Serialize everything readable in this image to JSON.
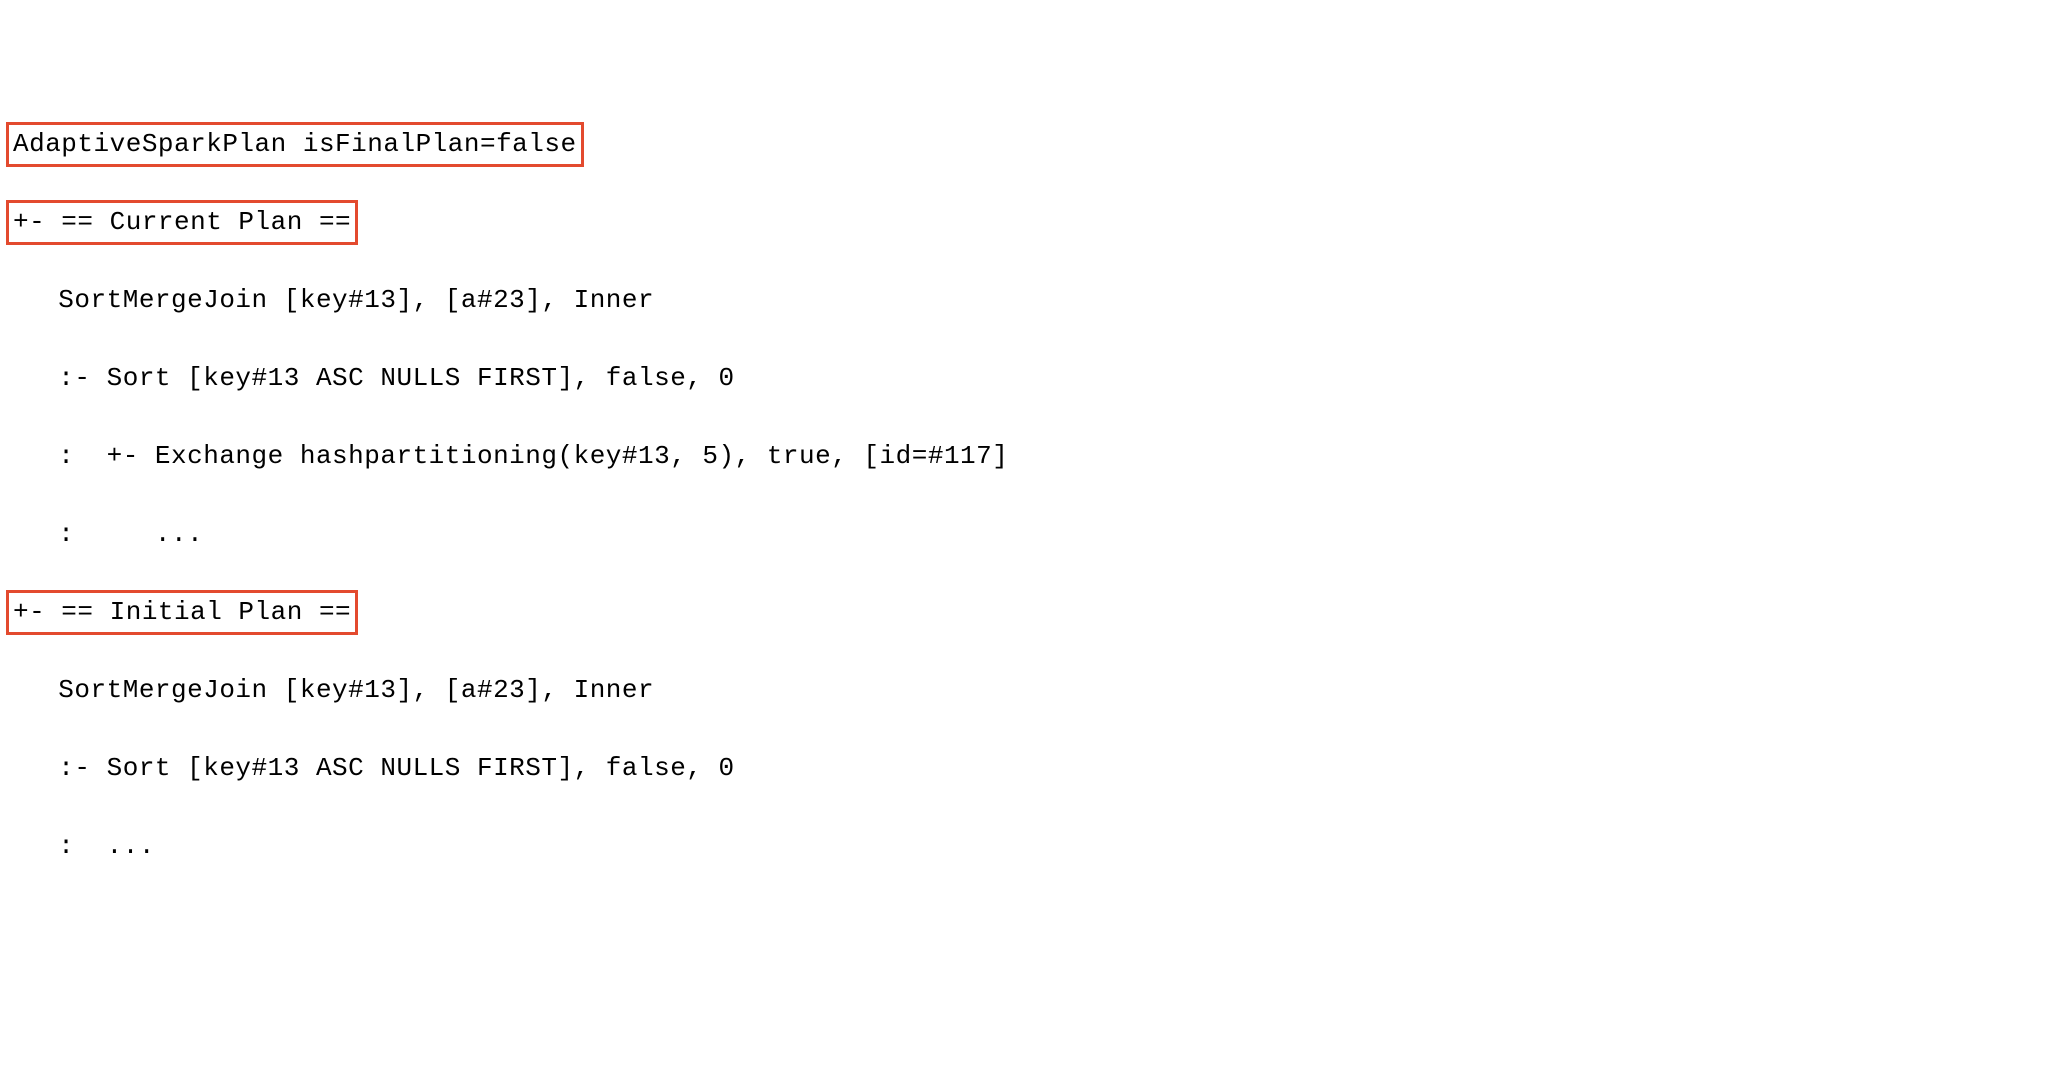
{
  "lines": {
    "l1": "AdaptiveSparkPlan isFinalPlan=false",
    "l2": "+- == Current Plan ==",
    "l3": "   SortMergeJoin [key#13], [a#23], Inner",
    "l4": "   :- Sort [key#13 ASC NULLS FIRST], false, 0",
    "l5": "   :  +- Exchange hashpartitioning(key#13, 5), true, [id=#117]",
    "l6": "   :     ...",
    "l7": "+- == Initial Plan ==",
    "l8": "   SortMergeJoin [key#13], [a#23], Inner",
    "l9": "   :- Sort [key#13 ASC NULLS FIRST], false, 0",
    "l10": "   :  ..."
  }
}
